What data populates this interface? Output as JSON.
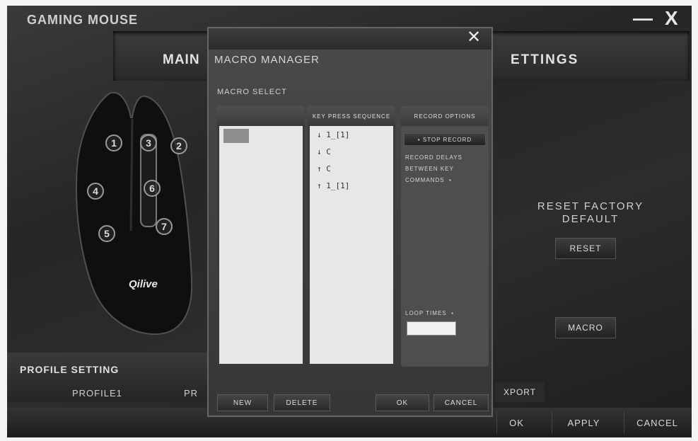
{
  "window": {
    "title": "GAMING MOUSE",
    "minimize": "—",
    "close": "X"
  },
  "tabs": {
    "main": "MAIN",
    "settings": "ETTINGS"
  },
  "mouse": {
    "buttons": [
      "1",
      "3",
      "2",
      "4",
      "6",
      "5",
      "7"
    ],
    "brand": "Qilive"
  },
  "reset": {
    "label_line1": "RESET FACTORY",
    "label_line2": "DEFAULT",
    "button": "RESET"
  },
  "macro_button": "MACRO",
  "profile": {
    "title": "PROFILE SETTING",
    "tab1": "PROFILE1",
    "tab2": "PR",
    "export": "XPORT"
  },
  "footer": {
    "ok": "OK",
    "apply": "APPLY",
    "cancel": "CANCEL"
  },
  "dialog": {
    "close": "✕",
    "title": "MACRO MANAGER",
    "section": "MACRO SELECT",
    "sequence_header": "KEY PRESS SEQUENCE",
    "options_header": "RECORD OPTIONS",
    "stop_record": "• STOP RECORD",
    "record_delays": "RECORD DELAYS",
    "between_key": "BETWEEN KEY",
    "commands": "COMMANDS",
    "commands_mark": "▪",
    "loop_times": "LOOP TIMES",
    "loop_mark": "▪",
    "sequence": [
      {
        "arrow": "↓",
        "key": "1_[1]"
      },
      {
        "arrow": "↓",
        "key": "C"
      },
      {
        "arrow": "↑",
        "key": "C"
      },
      {
        "arrow": "↑",
        "key": "1_[1]"
      }
    ],
    "buttons": {
      "new": "NEW",
      "delete": "DELETE",
      "ok": "OK",
      "cancel": "CANCEL"
    }
  }
}
